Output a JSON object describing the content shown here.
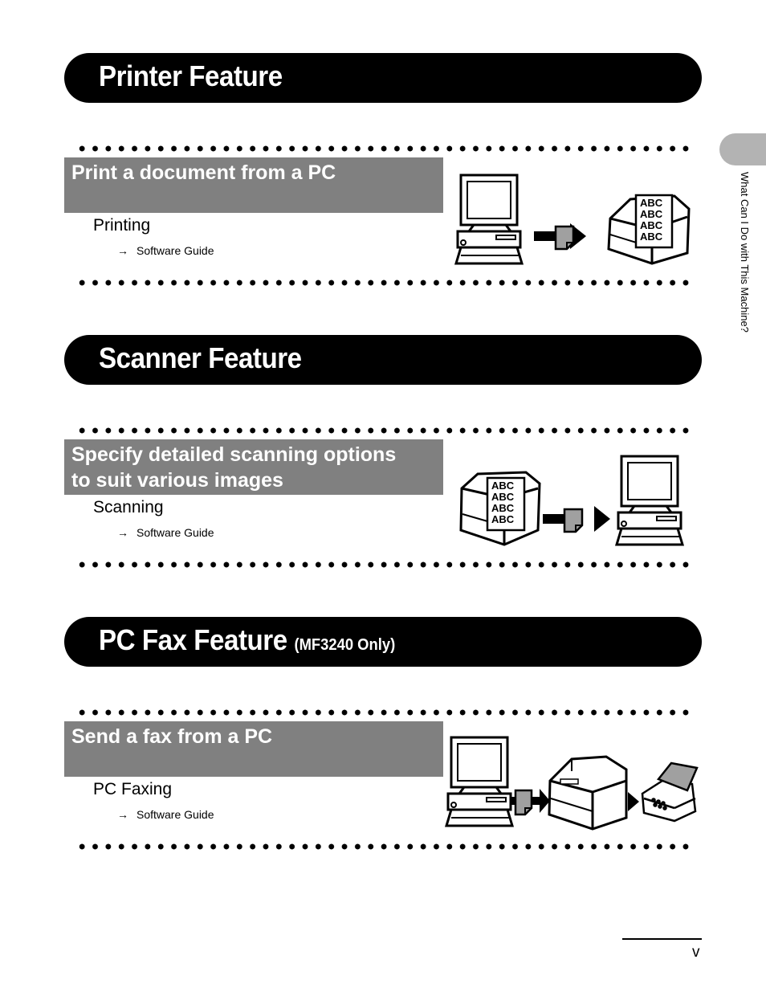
{
  "side_tab": {
    "label": "What Can I Do with This Machine?"
  },
  "sections": [
    {
      "title": "Printer Feature",
      "subtitle": "",
      "feature": {
        "heading": "Print a document from a PC",
        "item": "Printing",
        "ref_arrow": "→",
        "ref_text": "Software Guide"
      },
      "illustration": {
        "sheet_text": [
          "ABC",
          "ABC",
          "ABC",
          "ABC"
        ]
      }
    },
    {
      "title": "Scanner Feature",
      "subtitle": "",
      "feature": {
        "heading_line1": "Specify detailed scanning options",
        "heading_line2": "to suit various images",
        "item": "Scanning",
        "ref_arrow": "→",
        "ref_text": "Software Guide"
      },
      "illustration": {
        "sheet_text": [
          "ABC",
          "ABC",
          "ABC",
          "ABC"
        ]
      }
    },
    {
      "title": "PC Fax Feature",
      "subtitle": "(MF3240 Only)",
      "feature": {
        "heading": "Send a fax from a PC",
        "item": "PC Faxing",
        "ref_arrow": "→",
        "ref_text": "Software Guide"
      }
    }
  ],
  "footer": {
    "page_number": "v"
  },
  "colors": {
    "banner": "#000000",
    "subheading_bg": "#808080",
    "side_tab": "#b3b3b3",
    "doc_icon": "#a0a0a0"
  }
}
